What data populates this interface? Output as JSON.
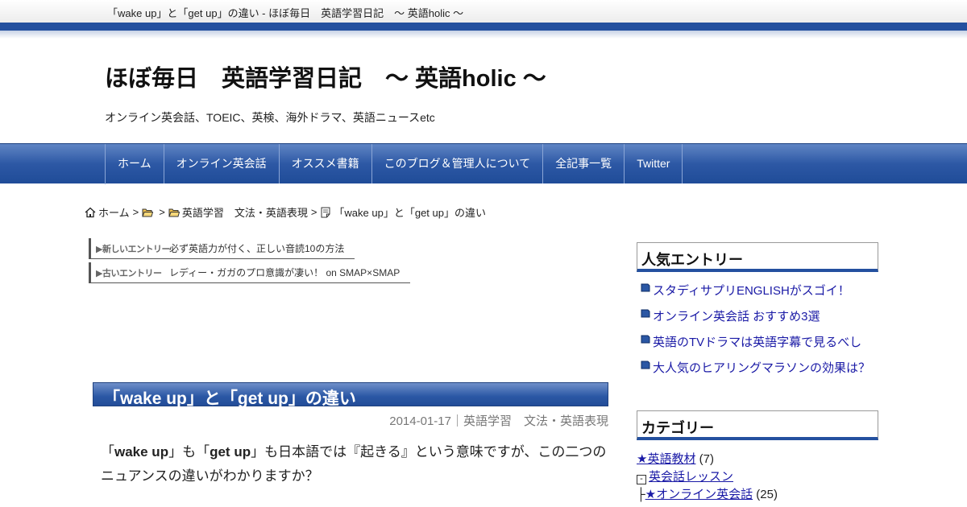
{
  "window": {
    "title": "「wake up」と「get up」の違い - ほぼ毎日　英語学習日記　～ 英語holic ～"
  },
  "site": {
    "title": "ほぼ毎日　英語学習日記　～ 英語holic ～",
    "description": "オンライン英会話、TOEIC、英検、海外ドラマ、英語ニュースetc"
  },
  "nav": {
    "items": [
      {
        "label": "ホーム"
      },
      {
        "label": "オンライン英会話"
      },
      {
        "label": "オススメ書籍"
      },
      {
        "label": "このブログ＆管理人について"
      },
      {
        "label": "全記事一覧"
      },
      {
        "label": "Twitter"
      }
    ]
  },
  "breadcrumb": {
    "home": "ホーム",
    "separator": ">",
    "category": "英語学習　文法・英語表現",
    "current": "「wake up」と「get up」の違い"
  },
  "entry_nav": {
    "newer_tag": "▶新しいエントリー",
    "newer_link": "必ず英語力が付く、正しい音読10の方法",
    "older_tag": "▶古いエントリー",
    "older_link": "レディー・ガガのプロ意識が凄い！ on SMAP×SMAP"
  },
  "post": {
    "title": "「wake up」と「get up」の違い",
    "date": "2014-01-17",
    "meta_separator": "｜",
    "category": "英語学習　文法・英語表現",
    "body_q1": "「",
    "body_w1": "wake up",
    "body_q2": "」も「",
    "body_w2": "get up",
    "body_rest": "」も日本語では『起きる』という意味ですが、この二つのニュアンスの違いがわかりますか？"
  },
  "sidebar": {
    "popular": {
      "title": "人気エントリー",
      "items": [
        {
          "label": "スタディサプリENGLISHがスゴイ！"
        },
        {
          "label": "オンライン英会話 おすすめ3選"
        },
        {
          "label": "英語のTVドラマは英語字幕で見るべし"
        },
        {
          "label": "大人気のヒアリングマラソンの効果は？"
        }
      ]
    },
    "categories": {
      "title": "カテゴリー",
      "items": [
        {
          "label": "★英語教材",
          "count": "(7)"
        },
        {
          "toggle": "-",
          "label": "英会話レッスン"
        },
        {
          "prefix": "├",
          "label": "★オンライン英会話",
          "count": "(25)"
        }
      ]
    }
  },
  "colors": {
    "accent": "#24509f",
    "link": "#1a1aa6"
  },
  "icons": {
    "home": "home-icon",
    "folder": "folder-icon",
    "document": "document-icon",
    "bullet": "bullet-icon"
  }
}
